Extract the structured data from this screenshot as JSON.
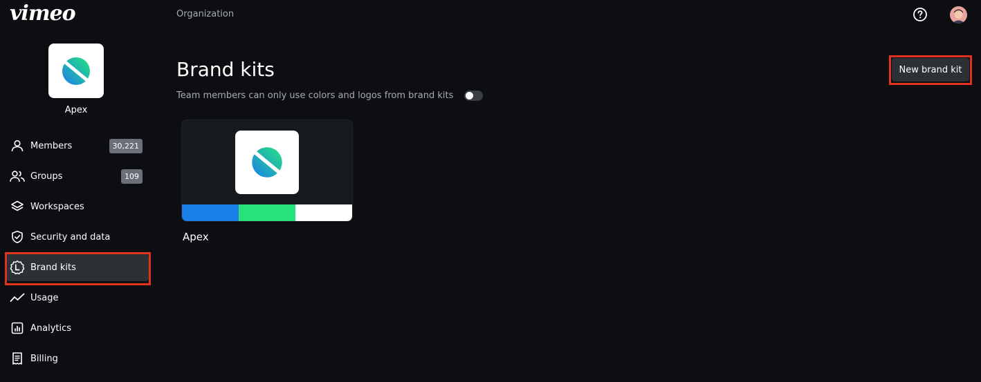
{
  "app": {
    "logo_text": "vimeo"
  },
  "header": {
    "breadcrumb": "Organization"
  },
  "organization": {
    "name": "Apex"
  },
  "sidebar": {
    "items": [
      {
        "label": "Members",
        "icon": "person-icon",
        "badge": "30,221"
      },
      {
        "label": "Groups",
        "icon": "people-icon",
        "badge": "109"
      },
      {
        "label": "Workspaces",
        "icon": "layers-icon"
      },
      {
        "label": "Security and data",
        "icon": "shield-check-icon"
      },
      {
        "label": "Brand kits",
        "icon": "brand-kit-badge-icon",
        "active": true
      },
      {
        "label": "Usage",
        "icon": "trend-line-icon"
      },
      {
        "label": "Analytics",
        "icon": "bar-chart-icon"
      },
      {
        "label": "Billing",
        "icon": "receipt-icon"
      }
    ]
  },
  "main": {
    "title": "Brand kits",
    "toggle_label": "Team members can only use colors and logos from brand kits",
    "toggle_on": false,
    "new_button_label": "New brand kit",
    "kits": [
      {
        "name": "Apex",
        "colors": [
          "#1b7fe8",
          "#26e37e",
          "#ffffff"
        ]
      }
    ]
  },
  "colors": {
    "background": "#0c0e12",
    "highlight": "#e1321d",
    "active_nav": "#2d3035"
  }
}
